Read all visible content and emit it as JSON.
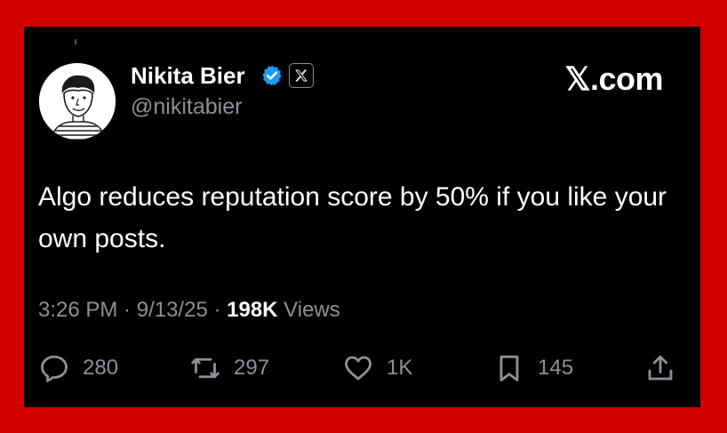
{
  "user": {
    "name": "Nikita Bier",
    "handle": "@nikitabier"
  },
  "brand": "𝕏.com",
  "tweet": {
    "text": "Algo reduces reputation score by 50% if you like your own posts."
  },
  "meta": {
    "time": "3:26 PM",
    "sep1": " · ",
    "date": "9/13/25",
    "sep2": " · ",
    "views_count": "198K",
    "views_label": " Views"
  },
  "actions": {
    "replies": "280",
    "reposts": "297",
    "likes": "1K",
    "bookmarks": "145"
  },
  "colors": {
    "background_border": "#d40000",
    "card": "#000000",
    "verified": "#1d9bf0",
    "muted": "#8b9197"
  }
}
